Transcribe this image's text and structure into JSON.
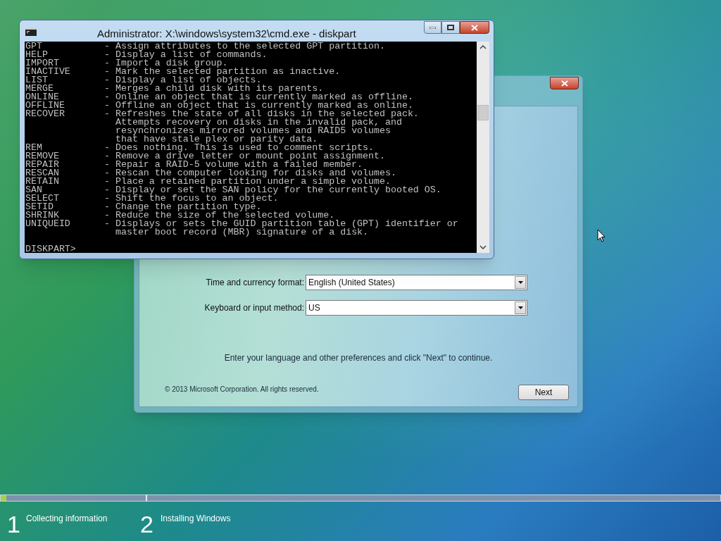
{
  "console_window": {
    "title": "Administrator: X:\\windows\\system32\\cmd.exe - diskpart",
    "lines": [
      {
        "command": "GPT",
        "description": "- Assign attributes to the selected GPT partition."
      },
      {
        "command": "HELP",
        "description": "- Display a list of commands."
      },
      {
        "command": "IMPORT",
        "description": "- Import a disk group."
      },
      {
        "command": "INACTIVE",
        "description": "- Mark the selected partition as inactive."
      },
      {
        "command": "LIST",
        "description": "- Display a list of objects."
      },
      {
        "command": "MERGE",
        "description": "- Merges a child disk with its parents."
      },
      {
        "command": "ONLINE",
        "description": "- Online an object that is currently marked as offline."
      },
      {
        "command": "OFFLINE",
        "description": "- Offline an object that is currently marked as online."
      },
      {
        "command": "RECOVER",
        "description": "- Refreshes the state of all disks in the selected pack."
      },
      {
        "description": "Attempts recovery on disks in the invalid pack, and"
      },
      {
        "description": "resynchronizes mirrored volumes and RAID5 volumes"
      },
      {
        "description": "that have stale plex or parity data."
      },
      {
        "command": "REM",
        "description": "- Does nothing. This is used to comment scripts."
      },
      {
        "command": "REMOVE",
        "description": "- Remove a drive letter or mount point assignment."
      },
      {
        "command": "REPAIR",
        "description": "- Repair a RAID-5 volume with a failed member."
      },
      {
        "command": "RESCAN",
        "description": "- Rescan the computer looking for disks and volumes."
      },
      {
        "command": "RETAIN",
        "description": "- Place a retained partition under a simple volume."
      },
      {
        "command": "SAN",
        "description": "- Display or set the SAN policy for the currently booted OS."
      },
      {
        "command": "SELECT",
        "description": "- Shift the focus to an object."
      },
      {
        "command": "SETID",
        "description": "- Change the partition type."
      },
      {
        "command": "SHRINK",
        "description": "- Reduce the size of the selected volume."
      },
      {
        "command": "UNIQUEID",
        "description": "- Displays or sets the GUID partition table (GPT) identifier or"
      },
      {
        "description": "master boot record (MBR) signature of a disk."
      }
    ],
    "prompt": "DISKPART>"
  },
  "setup_window": {
    "fields": [
      {
        "label": "Time and currency format:",
        "value": "English (United States)"
      },
      {
        "label": "Keyboard or input method:",
        "value": "US"
      }
    ],
    "instruction": "Enter your language and other preferences and click \"Next\" to continue.",
    "copyright": "© 2013 Microsoft Corporation. All rights reserved.",
    "next_button": "Next"
  },
  "progress": {
    "level": 0.008
  },
  "steps": [
    {
      "number": "1",
      "label": "Collecting information"
    },
    {
      "number": "2",
      "label": "Installing Windows"
    }
  ]
}
